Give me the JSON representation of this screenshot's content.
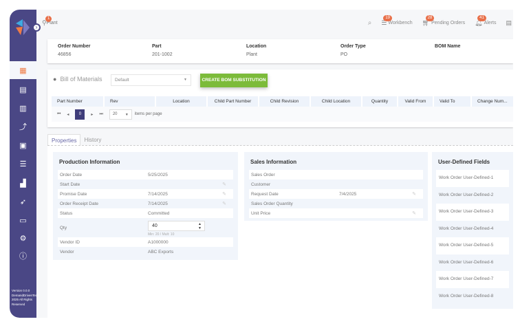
{
  "header": {
    "breadcrumb": "Plant",
    "breadcrumb_badge": "1",
    "items": [
      {
        "label": "Workbench",
        "badge": "19"
      },
      {
        "label": "Pending Orders",
        "badge": "28"
      },
      {
        "label": "Alerts",
        "badge": "41"
      }
    ]
  },
  "order": {
    "fields": [
      {
        "label": "Order Number",
        "value": "46856"
      },
      {
        "label": "Part",
        "value": "201-1002"
      },
      {
        "label": "Location",
        "value": "Plant"
      },
      {
        "label": "Order Type",
        "value": "PO"
      },
      {
        "label": "BOM Name",
        "value": ""
      }
    ]
  },
  "bom": {
    "title": "Bill of Materials",
    "select_value": "Default",
    "button": "CREATE BOM SUBSTITUTION",
    "columns": [
      "Part Number",
      "Rev",
      "Location",
      "Child Part Number",
      "Child Revision",
      "Child Location",
      "Quantity",
      "Valid From",
      "Valid To",
      "Change Num..."
    ],
    "page": "0",
    "page_size": "20",
    "items_per_page": "items per page"
  },
  "tabs": [
    "Properties",
    "History"
  ],
  "production": {
    "title": "Production Information",
    "rows": [
      {
        "label": "Order Date",
        "value": "5/25/2025"
      },
      {
        "label": "Start Date",
        "value": ""
      },
      {
        "label": "Promise Date",
        "value": "7/14/2025"
      },
      {
        "label": "Order Receipt Date",
        "value": "7/14/2025"
      },
      {
        "label": "Status",
        "value": "Committed"
      }
    ],
    "qty_label": "Qty",
    "qty_value": "40",
    "qty_hint": "Min: 20 / Mult: 10",
    "rows2": [
      {
        "label": "Vendor ID",
        "value": "A1000000"
      },
      {
        "label": "Vendor",
        "value": "ABC Exports"
      }
    ]
  },
  "sales": {
    "title": "Sales Information",
    "rows": [
      {
        "label": "Sales Order",
        "value": ""
      },
      {
        "label": "Customer",
        "value": ""
      },
      {
        "label": "Request Date",
        "value": "7/4/2025"
      },
      {
        "label": "Sales Order Quantity",
        "value": ""
      },
      {
        "label": "Unit Price",
        "value": ""
      }
    ]
  },
  "udf": {
    "title": "User-Defined Fields",
    "items": [
      "Work Order User-Defined-1",
      "Work Order User-Defined-2",
      "Work Order User-Defined-3",
      "Work Order User-Defined-4",
      "Work Order User-Defined-5",
      "Work Order User-Defined-6",
      "Work Order User-Defined-7",
      "Work Order User-Defined-8"
    ]
  },
  "sidebar": {
    "version": "Version 0.0.0 DemandDrivenTech 2025 All Rights Reserved"
  },
  "colors": {
    "sidebar": "#4a4785",
    "accent": "#ef7b45",
    "button": "#7cbb3a"
  }
}
